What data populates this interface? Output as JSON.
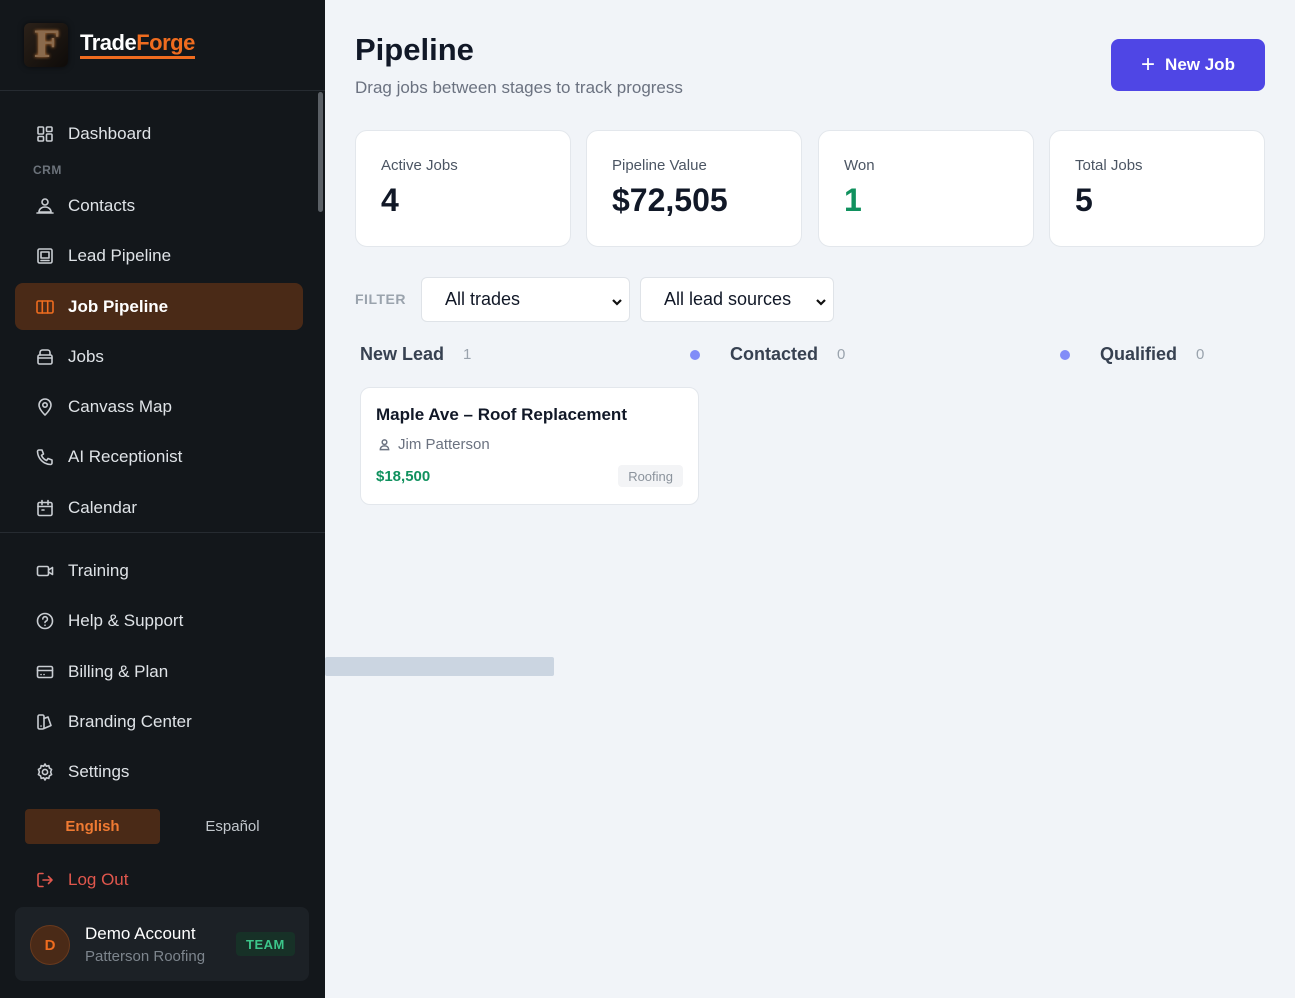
{
  "brand": {
    "name_part1": "Trade",
    "name_part2": "Forge",
    "logo_letter": "F"
  },
  "sidebar": {
    "section_label": "CRM",
    "items": [
      {
        "label": "Dashboard",
        "icon": "grid-icon"
      },
      {
        "label": "Contacts",
        "icon": "user-group-icon"
      },
      {
        "label": "Lead Pipeline",
        "icon": "clipboard-icon"
      },
      {
        "label": "Job Pipeline",
        "icon": "columns-icon",
        "active": true
      },
      {
        "label": "Jobs",
        "icon": "briefcase-icon"
      },
      {
        "label": "Canvass Map",
        "icon": "map-pin-icon"
      },
      {
        "label": "AI Receptionist",
        "icon": "phone-icon"
      },
      {
        "label": "Calendar",
        "icon": "calendar-icon"
      }
    ],
    "secondary_items": [
      {
        "label": "Training",
        "icon": "video-icon"
      },
      {
        "label": "Help & Support",
        "icon": "help-circle-icon"
      },
      {
        "label": "Billing & Plan",
        "icon": "credit-card-icon"
      },
      {
        "label": "Branding Center",
        "icon": "palette-icon"
      },
      {
        "label": "Settings",
        "icon": "gear-icon"
      }
    ],
    "languages": {
      "en": "English",
      "es": "Español",
      "selected": "English"
    },
    "logout_label": "Log Out",
    "account": {
      "initial": "D",
      "name": "Demo Account",
      "org": "Patterson Roofing",
      "badge": "TEAM"
    }
  },
  "header": {
    "title": "Pipeline",
    "subtitle": "Drag jobs between stages to track progress",
    "new_job_label": "New Job"
  },
  "stats": [
    {
      "label": "Active Jobs",
      "value": "4"
    },
    {
      "label": "Pipeline Value",
      "value": "$72,505"
    },
    {
      "label": "Won",
      "value": "1"
    },
    {
      "label": "Total Jobs",
      "value": "5"
    }
  ],
  "filters": {
    "label": "FILTER",
    "trades": "All trades",
    "lead_sources": "All lead sources"
  },
  "columns": [
    {
      "name": "New Lead",
      "count": "1"
    },
    {
      "name": "Contacted",
      "count": "0"
    },
    {
      "name": "Qualified",
      "count": "0"
    }
  ],
  "cards": [
    {
      "title": "Maple Ave – Roof Replacement",
      "contact": "Jim Patterson",
      "amount": "$18,500",
      "tag": "Roofing"
    }
  ],
  "colors": {
    "accent": "#ef6c1f",
    "primary": "#4f46e5",
    "positive": "#10915e",
    "stage_dot": "#818cf8"
  }
}
